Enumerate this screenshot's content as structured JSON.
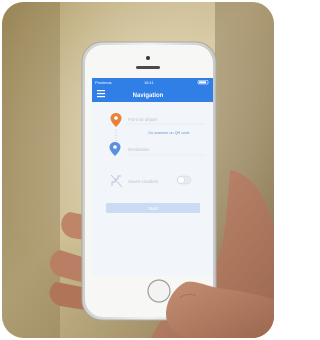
{
  "status_bar": {
    "carrier": "Proximus",
    "time": "15:11"
  },
  "app": {
    "title": "Navigation",
    "menu_icon": "hamburger-menu-icon",
    "start_placeholder": "Point de départ",
    "scan_link": "Ou scannez un QR code",
    "destination_placeholder": "Destination",
    "toggle_label": "Suivre escaliers",
    "start_button": "Start"
  },
  "colors": {
    "nav_blue": "#2f7fe6",
    "start_pin": "#e8823a",
    "destination_pin": "#5b8fe0",
    "button_disabled": "#c9dcf4"
  }
}
